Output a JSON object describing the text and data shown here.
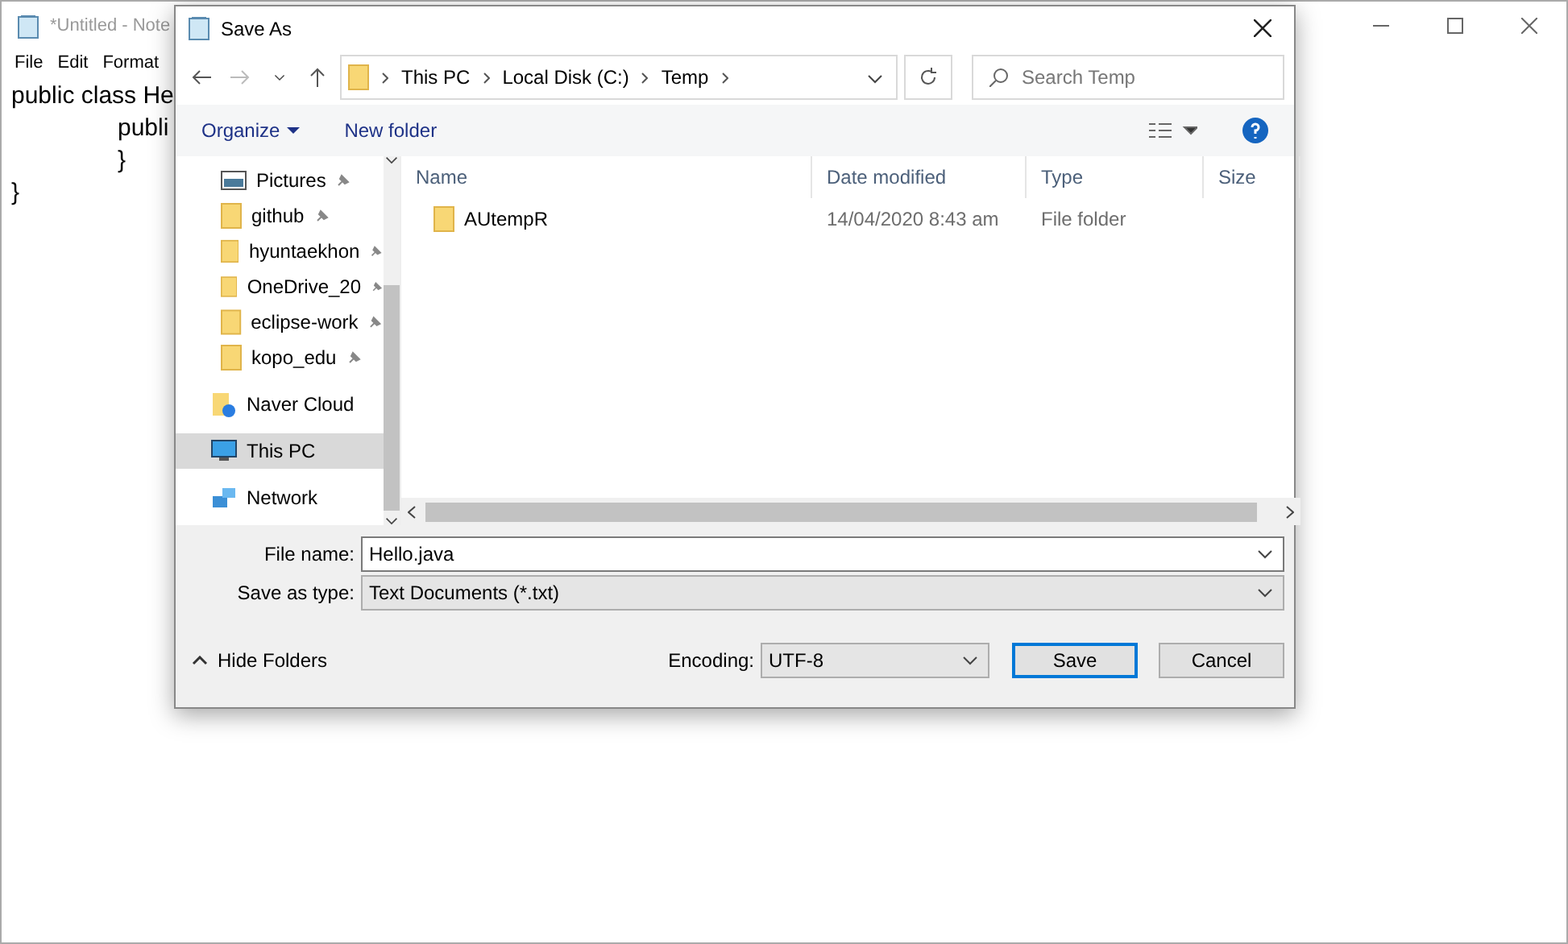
{
  "notepad": {
    "title": "*Untitled - Note",
    "menu": [
      "File",
      "Edit",
      "Format"
    ],
    "lines": [
      "public class He",
      "publi",
      "}",
      "}"
    ]
  },
  "dialog": {
    "title": "Save As",
    "breadcrumb": [
      "This PC",
      "Local Disk (C:)",
      "Temp"
    ],
    "search": {
      "placeholder": "Search Temp"
    },
    "toolbar": {
      "organize": "Organize",
      "new_folder": "New folder"
    },
    "sidebar": {
      "items": [
        {
          "label": "Pictures",
          "kind": "pictures",
          "pinned": true,
          "selected": false,
          "nested": true
        },
        {
          "label": "github",
          "kind": "folder",
          "pinned": true,
          "selected": false,
          "nested": true
        },
        {
          "label": "hyuntaekhon",
          "kind": "folder",
          "pinned": true,
          "selected": false,
          "nested": true
        },
        {
          "label": "OneDrive_20",
          "kind": "folder",
          "pinned": true,
          "selected": false,
          "nested": true
        },
        {
          "label": "eclipse-work",
          "kind": "folder",
          "pinned": true,
          "selected": false,
          "nested": true
        },
        {
          "label": "kopo_edu",
          "kind": "folder",
          "pinned": true,
          "selected": false,
          "nested": true
        },
        {
          "label": "Naver Cloud",
          "kind": "cloud",
          "pinned": false,
          "selected": false,
          "nested": false
        },
        {
          "label": "This PC",
          "kind": "pc",
          "pinned": false,
          "selected": true,
          "nested": false
        },
        {
          "label": "Network",
          "kind": "network",
          "pinned": false,
          "selected": false,
          "nested": false
        }
      ]
    },
    "table": {
      "columns": [
        "Name",
        "Date modified",
        "Type",
        "Size"
      ],
      "rows": [
        {
          "name": "AUtempR",
          "date": "14/04/2020 8:43 am",
          "type": "File folder"
        }
      ]
    },
    "file_name": {
      "label": "File name:",
      "value": "Hello.java"
    },
    "save_as_type": {
      "label": "Save as type:",
      "value": "Text Documents (*.txt)"
    },
    "hide_folders": "Hide Folders",
    "encoding": {
      "label": "Encoding:",
      "value": "UTF-8"
    },
    "buttons": [
      "Save",
      "Cancel"
    ]
  }
}
